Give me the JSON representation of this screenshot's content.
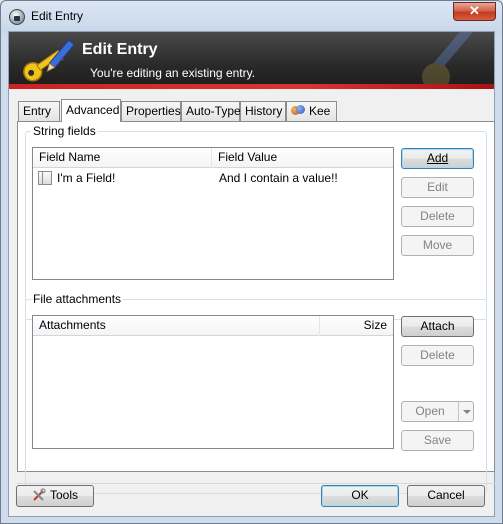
{
  "window": {
    "title": "Edit Entry",
    "close_glyph": "✕"
  },
  "banner": {
    "title": "Edit Entry",
    "subtitle": "You're editing an existing entry."
  },
  "tabs": [
    {
      "label": "Entry"
    },
    {
      "label": "Advanced",
      "active": true
    },
    {
      "label": "Properties"
    },
    {
      "label": "Auto-Type"
    },
    {
      "label": "History"
    },
    {
      "label": "Kee",
      "icon": "kee-icon"
    }
  ],
  "string_fields": {
    "legend": "String fields",
    "columns": [
      "Field Name",
      "Field Value"
    ],
    "rows": [
      {
        "name": "I'm a Field!",
        "value": "And I contain a value!!"
      }
    ],
    "buttons": {
      "add": {
        "label": "Add",
        "enabled": true
      },
      "edit": {
        "label": "Edit",
        "enabled": false
      },
      "delete": {
        "label": "Delete",
        "enabled": false
      },
      "move": {
        "label": "Move",
        "enabled": false
      }
    }
  },
  "file_attachments": {
    "legend": "File attachments",
    "columns": [
      "Attachments",
      "Size"
    ],
    "rows": [],
    "buttons": {
      "attach": {
        "label": "Attach",
        "enabled": true
      },
      "delete": {
        "label": "Delete",
        "enabled": false
      },
      "open": {
        "label": "Open",
        "enabled": false
      },
      "save": {
        "label": "Save",
        "enabled": false
      }
    }
  },
  "footer": {
    "tools": {
      "label": "Tools",
      "icon": "tools-icon"
    },
    "ok": {
      "label": "OK"
    },
    "cancel": {
      "label": "Cancel"
    }
  },
  "colors": {
    "banner_bg": "#2b2b2b",
    "banner_stripe": "#cc2222",
    "accent_key": "#f2c41a"
  }
}
